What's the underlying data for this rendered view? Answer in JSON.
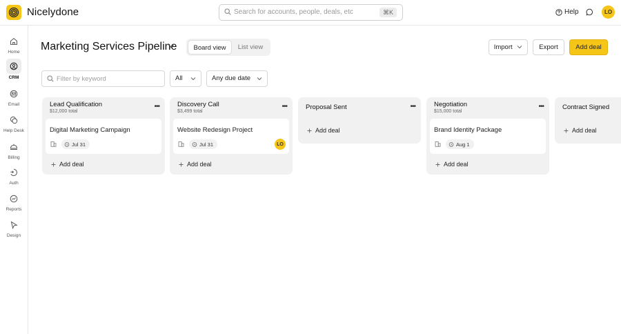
{
  "app": {
    "name": "Nicelydone",
    "search_placeholder": "Search for accounts, people, deals, etc",
    "search_shortcut": "⌘K",
    "help_label": "Help",
    "user_initials": "LO"
  },
  "sidebar": {
    "items": [
      {
        "label": "Home",
        "icon": "home-icon",
        "active": false
      },
      {
        "label": "CRM",
        "icon": "crm-icon",
        "active": true
      },
      {
        "label": "Email",
        "icon": "email-icon",
        "active": false
      },
      {
        "label": "Help Desk",
        "icon": "help-desk-icon",
        "active": false
      },
      {
        "label": "Billing",
        "icon": "billing-icon",
        "active": false
      },
      {
        "label": "Auth",
        "icon": "auth-icon",
        "active": false
      },
      {
        "label": "Reports",
        "icon": "reports-icon",
        "active": false
      },
      {
        "label": "Design",
        "icon": "design-icon",
        "active": false
      }
    ]
  },
  "header": {
    "title": "Marketing Services Pipeline",
    "views": {
      "board": "Board view",
      "list": "List view",
      "selected": "Board view"
    },
    "import_label": "Import",
    "export_label": "Export",
    "add_deal_label": "Add deal"
  },
  "filters": {
    "keyword_placeholder": "Filter by keyword",
    "scope": "All",
    "due_date": "Any due date"
  },
  "columns": [
    {
      "title": "Lead Qualification",
      "total": "$12,000 total",
      "cards": [
        {
          "title": "Digital Marketing Campaign",
          "date": "Jul 31",
          "owner": ""
        }
      ],
      "add_label": "Add deal"
    },
    {
      "title": "Discovery Call",
      "total": "$3,499 total",
      "cards": [
        {
          "title": "Website Redesign Project",
          "date": "Jul 31",
          "owner": "LO"
        }
      ],
      "add_label": "Add deal"
    },
    {
      "title": "Proposal Sent",
      "total": "",
      "cards": [],
      "add_label": "Add deal"
    },
    {
      "title": "Negotiation",
      "total": "$15,000 total",
      "cards": [
        {
          "title": "Brand Identity Package",
          "date": "Aug 1",
          "owner": ""
        }
      ],
      "add_label": "Add deal"
    },
    {
      "title": "Contract Signed",
      "total": "",
      "cards": [],
      "add_label": "Add deal"
    }
  ],
  "colors": {
    "accent": "#f5c518",
    "column_bg": "#f1f1f1",
    "border": "#e6e6e6"
  }
}
